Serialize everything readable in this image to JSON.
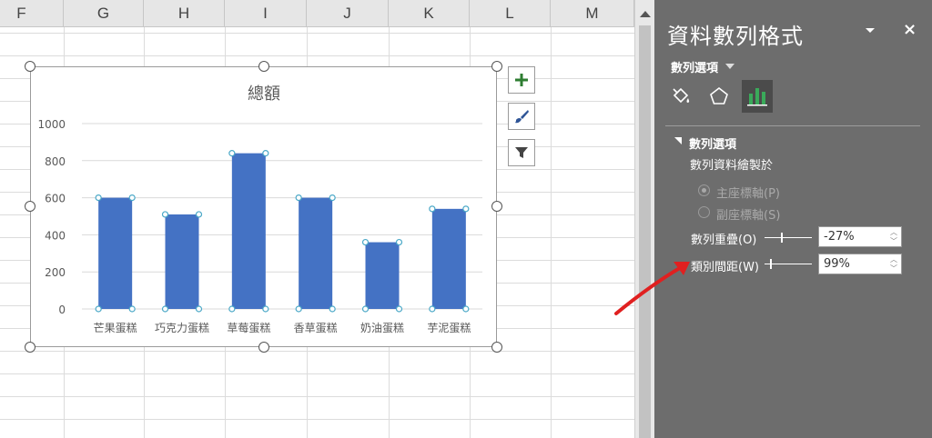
{
  "sheet": {
    "columns": [
      "F",
      "G",
      "H",
      "I",
      "J",
      "K",
      "L",
      "M"
    ]
  },
  "chart_data": {
    "type": "bar",
    "title": "總額",
    "categories": [
      "芒果蛋糕",
      "巧克力蛋糕",
      "草莓蛋糕",
      "香草蛋糕",
      "奶油蛋糕",
      "芋泥蛋糕"
    ],
    "values": [
      600,
      510,
      840,
      600,
      360,
      540
    ],
    "ylim": [
      0,
      1000
    ],
    "yticks": [
      "0",
      "200",
      "400",
      "600",
      "800",
      "1000"
    ],
    "grid": true,
    "bar_color": "#4472c4"
  },
  "chart_tools": {
    "add_element_icon": "plus-icon",
    "style_icon": "brush-icon",
    "filter_icon": "filter-icon"
  },
  "pane": {
    "title": "資料數列格式",
    "close": "×",
    "submenu": "數列選項",
    "tabs": [
      "fill-line-icon",
      "effects-icon",
      "series-options-icon"
    ],
    "section": "數列選項",
    "plot_on": "數列資料繪製於",
    "primary_axis": "主座標軸(P)",
    "secondary_axis": "副座標軸(S)",
    "overlap_label": "數列重疊(O)",
    "overlap_value": "-27%",
    "gap_label": "類別間距(W)",
    "gap_value": "99%"
  },
  "colors": {
    "pane_bg": "#6d6d6d",
    "annotation": "#e02020"
  }
}
